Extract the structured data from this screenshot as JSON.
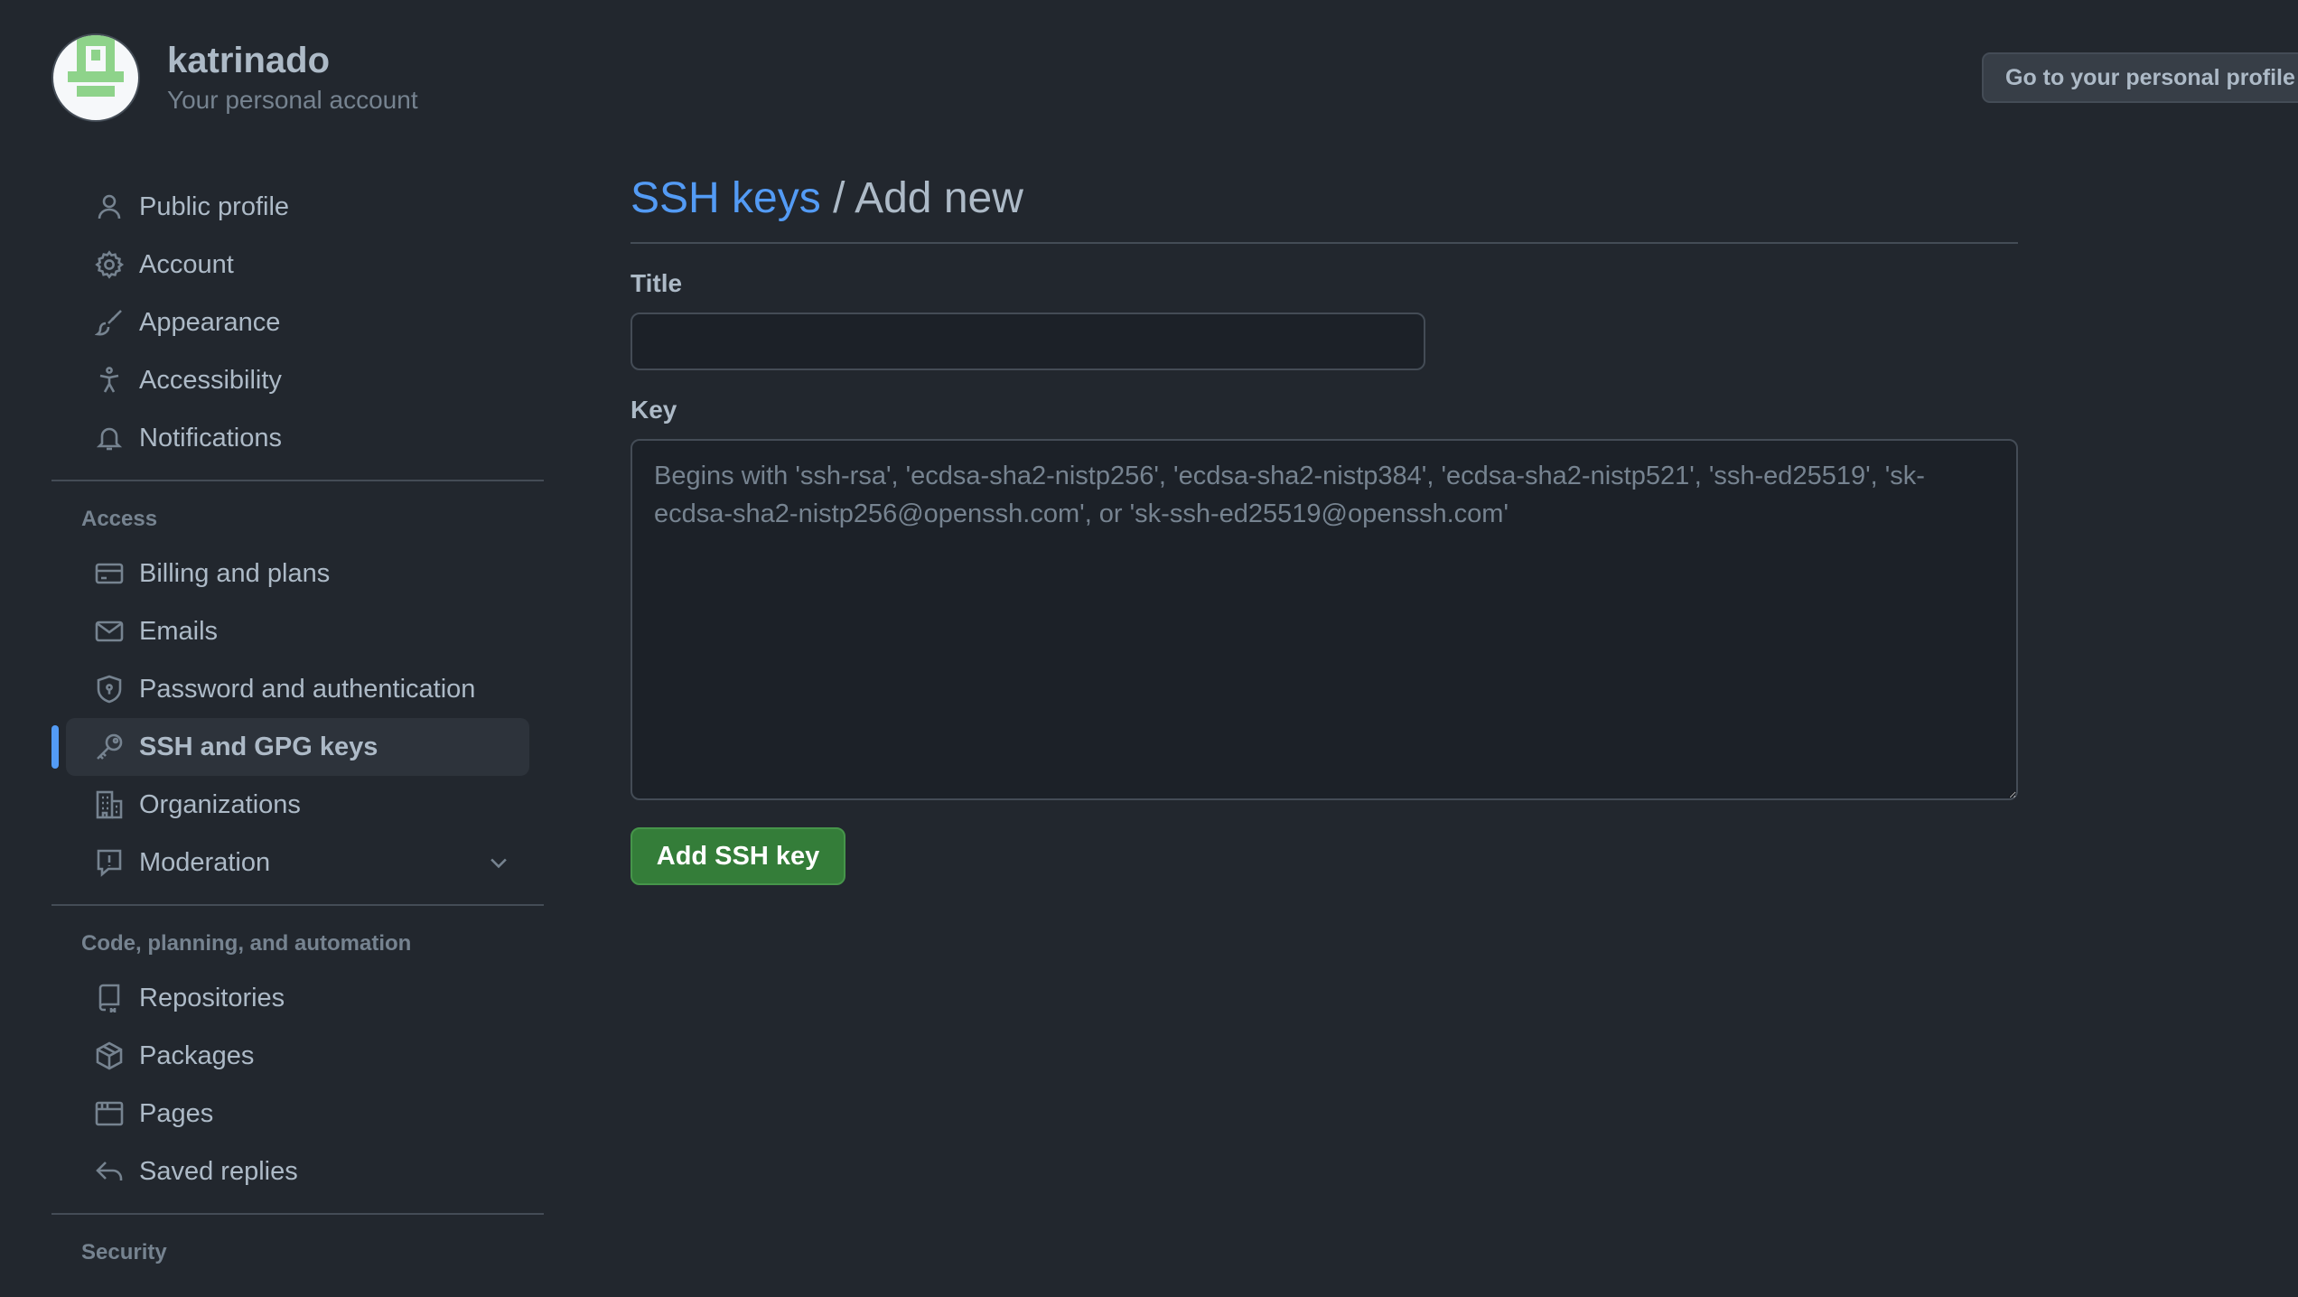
{
  "header": {
    "username": "katrinado",
    "account_subtitle": "Your personal account",
    "profile_button_label": "Go to your personal profile"
  },
  "sidebar": {
    "items_top": [
      {
        "label": "Public profile",
        "icon": "person-icon"
      },
      {
        "label": "Account",
        "icon": "gear-icon"
      },
      {
        "label": "Appearance",
        "icon": "paintbrush-icon"
      },
      {
        "label": "Accessibility",
        "icon": "accessibility-icon"
      },
      {
        "label": "Notifications",
        "icon": "bell-icon"
      }
    ],
    "access_heading": "Access",
    "items_access": [
      {
        "label": "Billing and plans",
        "icon": "credit-card-icon"
      },
      {
        "label": "Emails",
        "icon": "mail-icon"
      },
      {
        "label": "Password and authentication",
        "icon": "shield-lock-icon"
      },
      {
        "label": "SSH and GPG keys",
        "icon": "key-icon",
        "selected": true
      },
      {
        "label": "Organizations",
        "icon": "organization-icon"
      },
      {
        "label": "Moderation",
        "icon": "report-icon",
        "expandable": true
      }
    ],
    "code_heading": "Code, planning, and automation",
    "items_code": [
      {
        "label": "Repositories",
        "icon": "repo-icon"
      },
      {
        "label": "Packages",
        "icon": "package-icon"
      },
      {
        "label": "Pages",
        "icon": "browser-icon"
      },
      {
        "label": "Saved replies",
        "icon": "reply-icon"
      }
    ],
    "security_heading": "Security"
  },
  "main": {
    "breadcrumb_link": "SSH keys",
    "breadcrumb_separator": " / ",
    "page_title": "Add new",
    "title_label": "Title",
    "title_value": "",
    "key_label": "Key",
    "key_placeholder": "Begins with 'ssh-rsa', 'ecdsa-sha2-nistp256', 'ecdsa-sha2-nistp384', 'ecdsa-sha2-nistp521', 'ssh-ed25519', 'sk-ecdsa-sha2-nistp256@openssh.com', or 'sk-ssh-ed25519@openssh.com'",
    "submit_label": "Add SSH key"
  },
  "colors": {
    "background": "#22272e",
    "accent": "#539bf5",
    "primary_button": "#347d39",
    "avatar_green": "#8ed38a"
  }
}
